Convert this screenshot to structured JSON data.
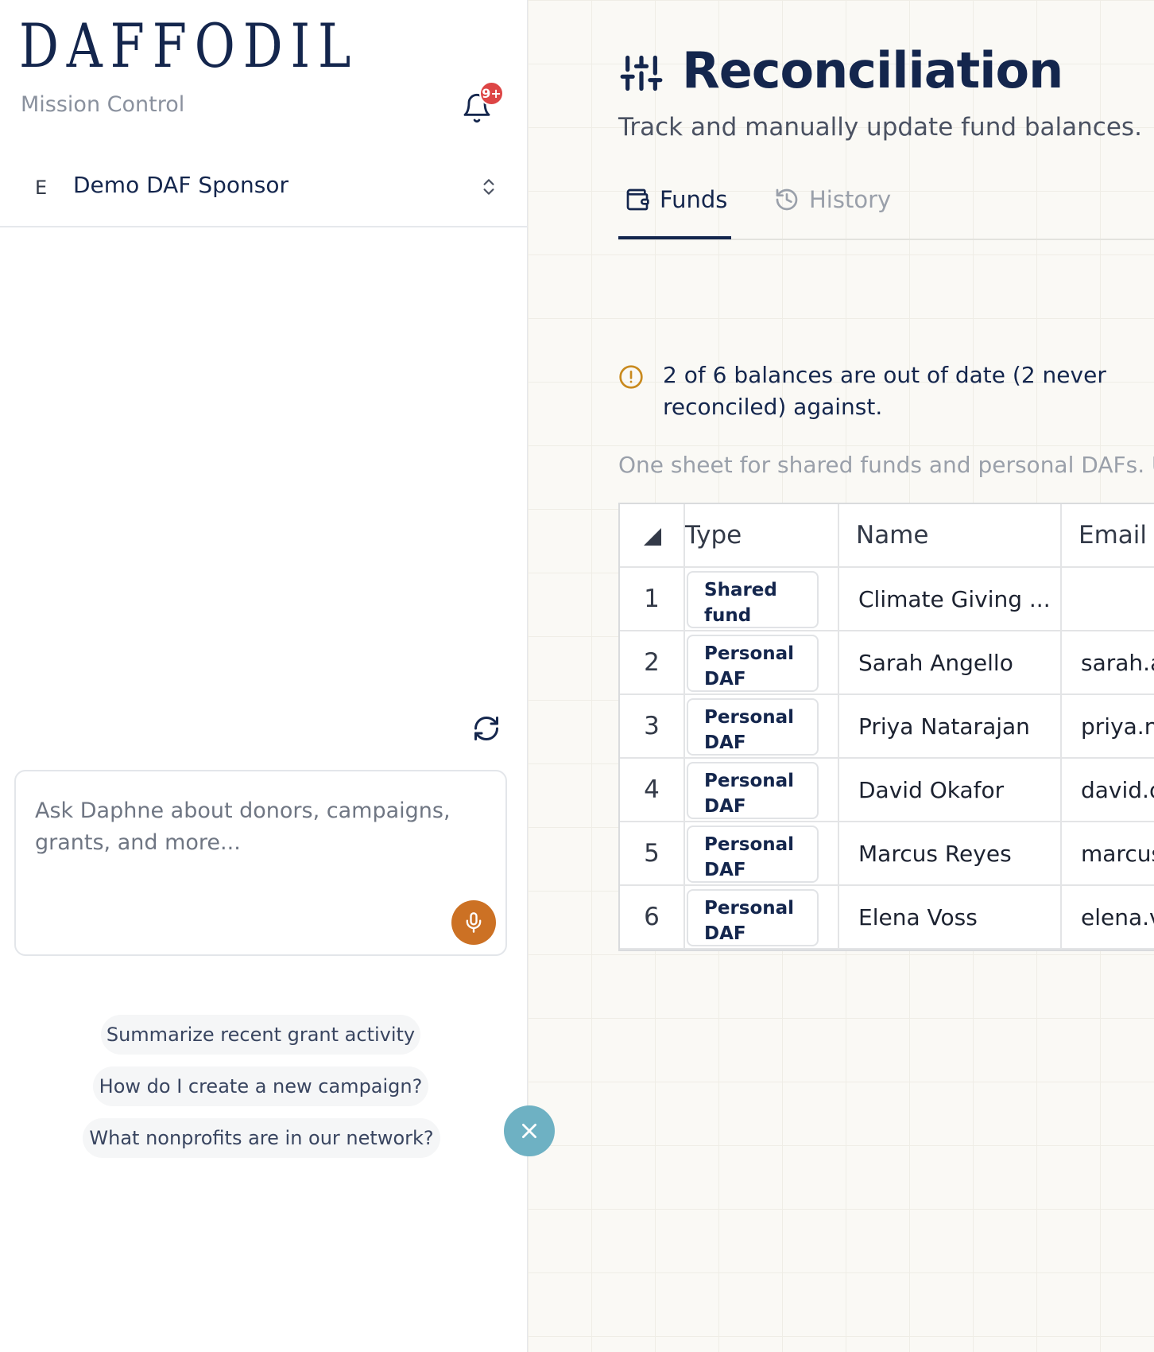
{
  "sidebar": {
    "logo": "DAFFODIL",
    "subtitle": "Mission Control",
    "notification_badge": "9+",
    "org": {
      "initial": "E",
      "name": "Demo DAF Sponsor"
    },
    "chat_placeholder": "Ask Daphne about donors, campaigns, grants, and more...",
    "suggestions": [
      "Summarize recent grant activity",
      "How do I create a new campaign?",
      "What nonprofits are in our network?"
    ]
  },
  "main": {
    "title": "Reconciliation",
    "description": "Track and manually update fund balances.",
    "tabs": [
      {
        "label": "Funds",
        "icon": "wallet-icon",
        "active": true
      },
      {
        "label": "History",
        "icon": "history-icon",
        "active": false
      }
    ],
    "alert": "2 of 6 balances are out of date (2 never reconciled) against.",
    "hint": "One sheet for shared funds and personal DAFs. Uplo",
    "table": {
      "headers": [
        "Type",
        "Name",
        "Email"
      ],
      "rows": [
        {
          "num": "1",
          "type": "Shared fund",
          "name": "Climate Giving ...",
          "email": ""
        },
        {
          "num": "2",
          "type": "Personal DAF",
          "name": "Sarah Angello",
          "email": "sarah.a"
        },
        {
          "num": "3",
          "type": "Personal DAF",
          "name": "Priya Natarajan",
          "email": "priya.na"
        },
        {
          "num": "4",
          "type": "Personal DAF",
          "name": "David Okafor",
          "email": "david.o"
        },
        {
          "num": "5",
          "type": "Personal DAF",
          "name": "Marcus Reyes",
          "email": "marcus"
        },
        {
          "num": "6",
          "type": "Personal DAF",
          "name": "Elena Voss",
          "email": "elena.v"
        }
      ]
    }
  },
  "colors": {
    "brand_navy": "#14264d",
    "mic_orange": "#cc7124",
    "close_teal": "#6eb1c3",
    "badge_red": "#dd4545",
    "alert_amber": "#c98a1e"
  }
}
